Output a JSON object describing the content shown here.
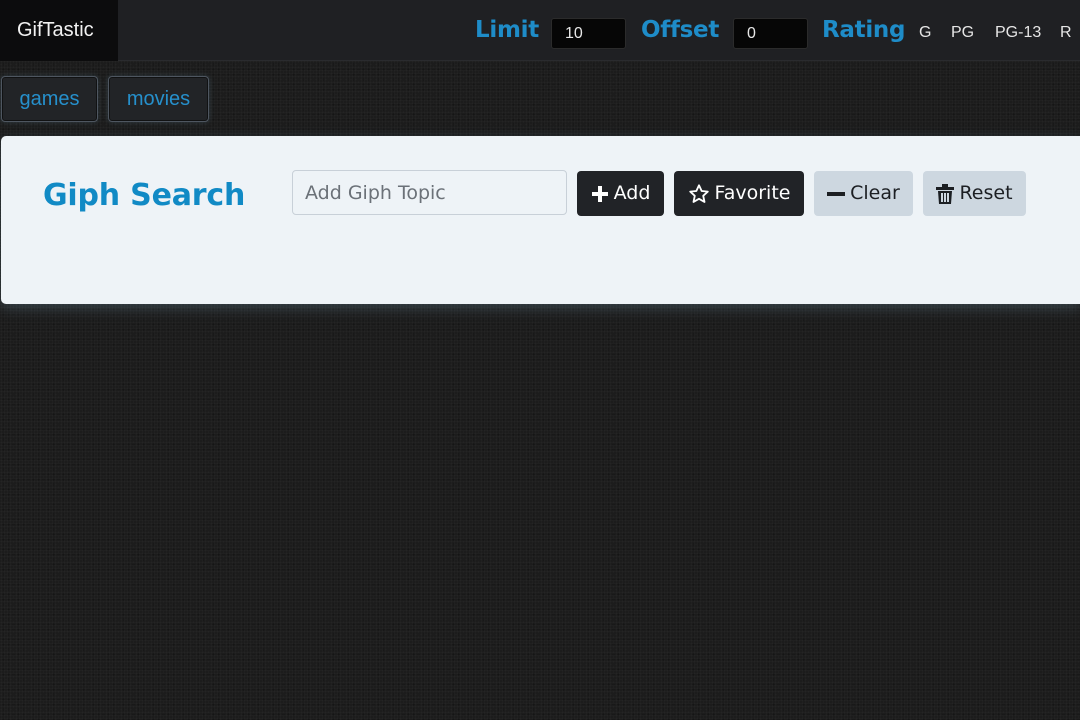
{
  "navbar": {
    "brand": "GifTastic",
    "limit_label": "Limit",
    "limit_value": "10",
    "offset_label": "Offset",
    "offset_value": "0",
    "rating_label": "Rating",
    "ratings": [
      "G",
      "PG",
      "PG-13",
      "R"
    ]
  },
  "topics": [
    "games",
    "movies"
  ],
  "search": {
    "title": "Giph Search",
    "placeholder": "Add Giph Topic",
    "add_label": "Add",
    "favorite_label": "Favorite",
    "clear_label": "Clear",
    "reset_label": "Reset"
  },
  "colors": {
    "accent": "#118ac5",
    "navbar_bg": "#1f2023",
    "panel_bg": "#eef3f7",
    "dark_button": "#212327",
    "light_button": "#cdd7e0"
  },
  "icons": {
    "add": "plus-icon",
    "favorite": "star-outline-icon",
    "clear": "minus-icon",
    "reset": "trash-icon"
  }
}
